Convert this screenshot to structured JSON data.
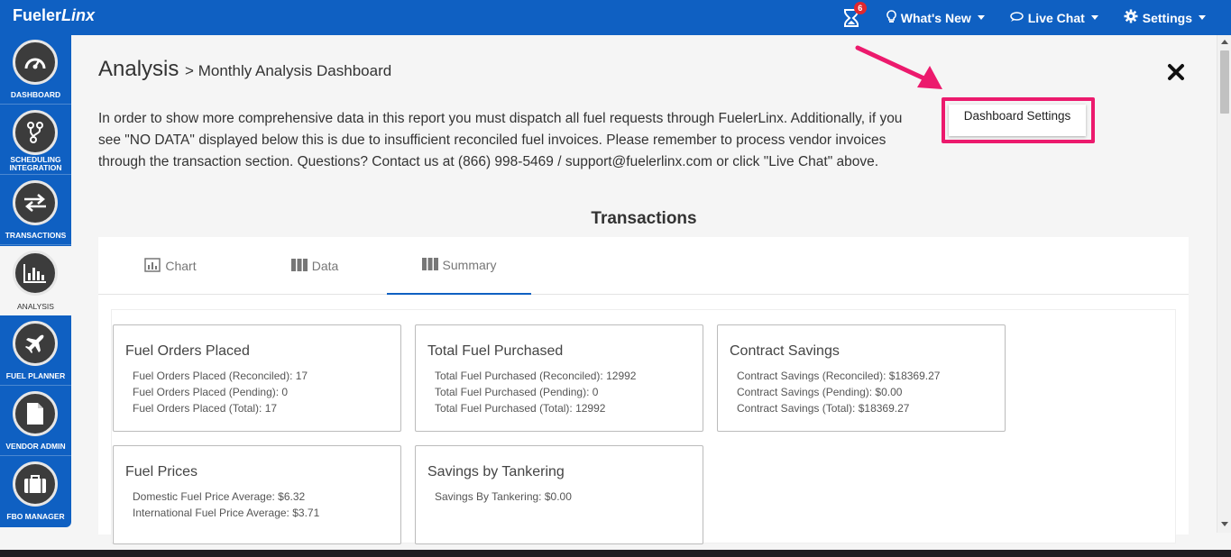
{
  "header": {
    "brand_plain": "Fueler",
    "brand_italic": "Linx",
    "notification_count": "6",
    "whats_new": "What's New",
    "live_chat": "Live Chat",
    "settings": "Settings"
  },
  "sidebar": {
    "items": [
      {
        "label": "DASHBOARD",
        "icon": "speedometer-icon"
      },
      {
        "label": "SCHEDULING INTEGRATION",
        "icon": "branch-icon"
      },
      {
        "label": "TRANSACTIONS",
        "icon": "exchange-icon"
      },
      {
        "label": "ANALYSIS",
        "icon": "bar-chart-icon",
        "active": true
      },
      {
        "label": "FUEL PLANNER",
        "icon": "plane-icon"
      },
      {
        "label": "VENDOR ADMIN",
        "icon": "document-icon"
      },
      {
        "label": "FBO MANAGER",
        "icon": "briefcase-icon"
      }
    ]
  },
  "page": {
    "title": "Analysis",
    "subtitle": "> Monthly Analysis Dashboard",
    "intro": "In order to show more comprehensive data in this report you must dispatch all fuel requests through FuelerLinx. Additionally, if you see \"NO DATA\" displayed below this is due to insufficient reconciled fuel invoices. Please remember to process vendor invoices through the transaction section. Questions? Contact us at (866) 998-5469 / support@fuelerlinx.com or click \"Live Chat\" above.",
    "dashboard_settings": "Dashboard Settings",
    "section_title": "Transactions"
  },
  "tabs": [
    {
      "label": "Chart",
      "icon": "chart-icon"
    },
    {
      "label": "Data",
      "icon": "columns-icon"
    },
    {
      "label": "Summary",
      "icon": "columns-icon",
      "active": true
    }
  ],
  "cards": [
    {
      "title": "Fuel Orders Placed",
      "lines": [
        "Fuel Orders Placed (Reconciled): 17",
        "Fuel Orders Placed (Pending): 0",
        "Fuel Orders Placed (Total): 17"
      ]
    },
    {
      "title": "Total Fuel Purchased",
      "lines": [
        "Total Fuel Purchased (Reconciled): 12992",
        "Total Fuel Purchased (Pending): 0",
        "Total Fuel Purchased (Total): 12992"
      ]
    },
    {
      "title": "Contract Savings",
      "lines": [
        "Contract Savings (Reconciled): $18369.27",
        "Contract Savings (Pending): $0.00",
        "Contract Savings (Total): $18369.27"
      ]
    },
    {
      "title": "Fuel Prices",
      "lines": [
        "Domestic Fuel Price Average: $6.32",
        "International Fuel Price Average: $3.71"
      ]
    },
    {
      "title": "Savings by Tankering",
      "lines": [
        "Savings By Tankering: $0.00"
      ]
    }
  ],
  "colors": {
    "brand_blue": "#0f60c2",
    "highlight_pink": "#ec1a6d",
    "badge_red": "#e0282e"
  }
}
